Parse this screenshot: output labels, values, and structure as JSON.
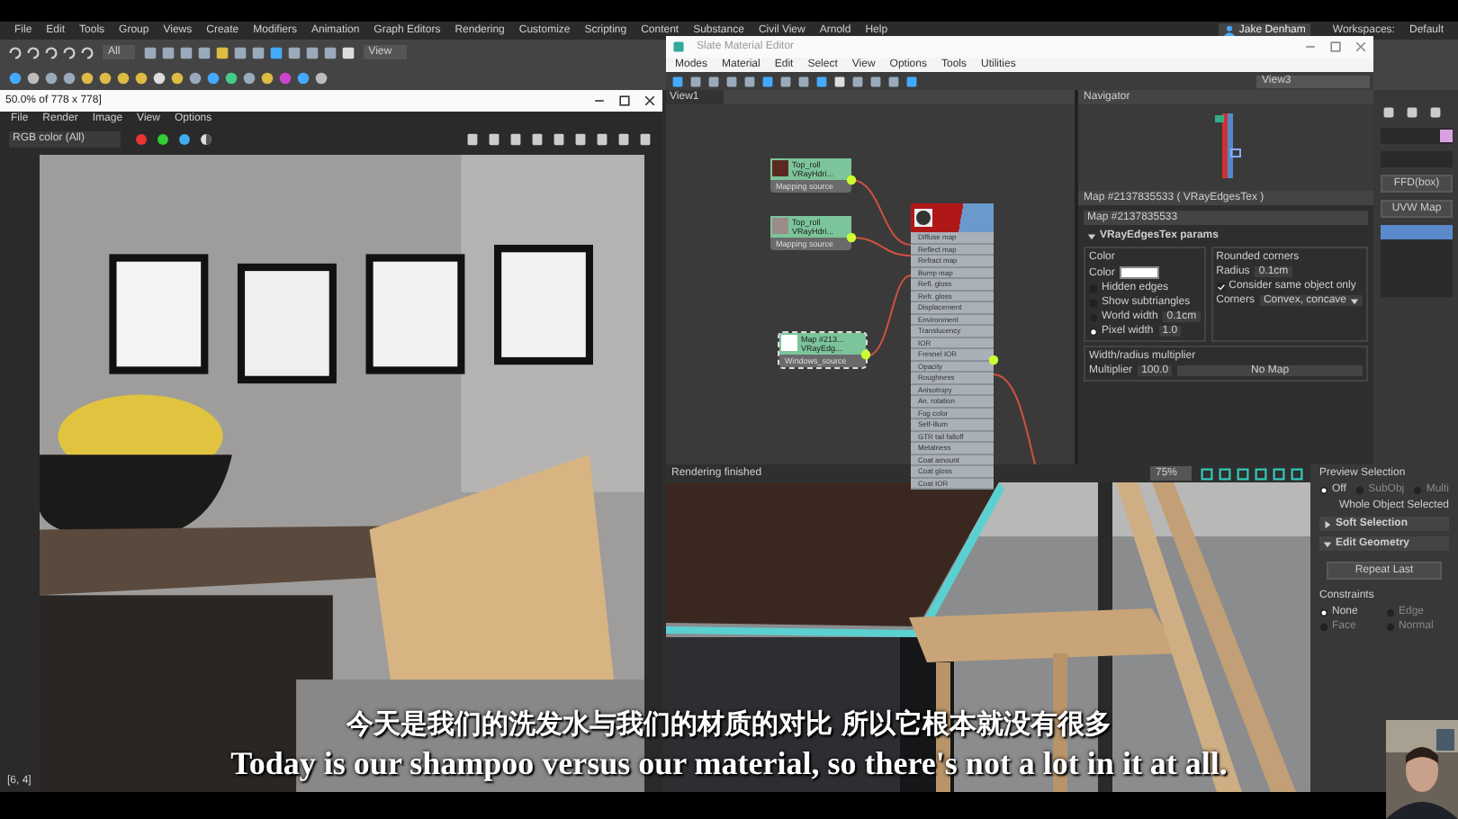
{
  "menu_bar": {
    "items": [
      "File",
      "Edit",
      "Tools",
      "Group",
      "Views",
      "Create",
      "Modifiers",
      "Animation",
      "Graph Editors",
      "Rendering",
      "Customize",
      "Scripting",
      "Content",
      "Substance",
      "Civil View",
      "Arnold",
      "Help"
    ],
    "user": "Jake Denham",
    "workspace_label": "Workspaces:",
    "workspace": "Default"
  },
  "toolbar": {
    "selection_filter": "All",
    "reference_system": "View"
  },
  "render_window": {
    "title": "50.0% of 778 x 778]",
    "menu": [
      "File",
      "Render",
      "Image",
      "View",
      "Options"
    ],
    "channel": "RGB color (All)",
    "coords": "[6, 4]"
  },
  "slate_editor": {
    "title": "Slate Material Editor",
    "menu": [
      "Modes",
      "Material",
      "Edit",
      "Select",
      "View",
      "Options",
      "Tools",
      "Utilities"
    ],
    "view_tab": "View1",
    "view_dropdown": "View3",
    "nodes": [
      {
        "title": "Top_roll",
        "subtitle": "VRayHdri...",
        "slot": "Mapping source",
        "color": "#5a2a20",
        "selected": false
      },
      {
        "title": "Top_roll",
        "subtitle": "VRayHdri...",
        "slot": "Mapping source",
        "color": "#9a8c88",
        "selected": false
      },
      {
        "title": "Map #213...",
        "subtitle": "VRayEdg...",
        "slot": "Windows_source",
        "color": "#ffffff",
        "selected": true
      }
    ],
    "material_ports": [
      "Diffuse map",
      "Reflect map",
      "Refract map",
      "Bump map",
      "Refl. gloss",
      "Refr. gloss",
      "Displacement",
      "Environment",
      "Translucency",
      "IOR",
      "Fresnel IOR",
      "Opacity",
      "Roughness",
      "Anisotropy",
      "An. rotation",
      "Fog color",
      "Self-illum",
      "GTR tail falloff",
      "Metalness",
      "Coat amount",
      "Coat gloss",
      "Coat IOR"
    ],
    "navigator": {
      "title": "Navigator"
    },
    "params": {
      "title": "Map #2137835533 ( VRayEdgesTex )",
      "name": "Map #2137835533",
      "rollout": "VRayEdgesTex params",
      "color_group": "Color",
      "color_label": "Color",
      "color": "#ffffff",
      "options": [
        {
          "kind": "check",
          "label": "Hidden edges",
          "checked": false
        },
        {
          "kind": "check",
          "label": "Show subtriangles",
          "checked": false
        },
        {
          "kind": "radio",
          "label": "World width",
          "value": "0.1cm",
          "selected": false
        },
        {
          "kind": "radio",
          "label": "Pixel width",
          "value": "1.0",
          "selected": true
        }
      ],
      "corners_group": "Rounded corners",
      "radius_label": "Radius",
      "radius": "0.1cm",
      "same_object": {
        "label": "Consider same object only",
        "checked": true
      },
      "corners_label": "Corners",
      "corners": "Convex, concave",
      "multiplier_group": "Width/radius multiplier",
      "multiplier_label": "Multiplier",
      "multiplier": "100.0",
      "map_button": "No Map"
    }
  },
  "viewport": {
    "status": "Rendering finished",
    "zoom": "75%"
  },
  "command_panel": {
    "modifiers": [
      "FFD(box)",
      "UVW Map"
    ],
    "preview_title": "Preview Selection",
    "preview_options": [
      {
        "label": "Off",
        "selected": true
      },
      {
        "label": "SubObj",
        "selected": false
      },
      {
        "label": "Multi",
        "selected": false
      }
    ],
    "selection_info": "Whole Object Selected",
    "rollouts": [
      {
        "title": "Soft Selection",
        "expanded": false
      },
      {
        "title": "Edit Geometry",
        "expanded": true
      }
    ],
    "repeat_button": "Repeat Last",
    "constraints_title": "Constraints",
    "constraints": [
      {
        "label": "None",
        "selected": true
      },
      {
        "label": "Edge",
        "selected": false
      },
      {
        "label": "Face",
        "selected": false
      },
      {
        "label": "Normal",
        "selected": false
      }
    ]
  },
  "subtitles": {
    "chinese": "今天是我们的洗发水与我们的材质的对比 所以它根本就没有很多",
    "english": "Today is our shampoo versus our material, so there's not a lot in it at all."
  }
}
